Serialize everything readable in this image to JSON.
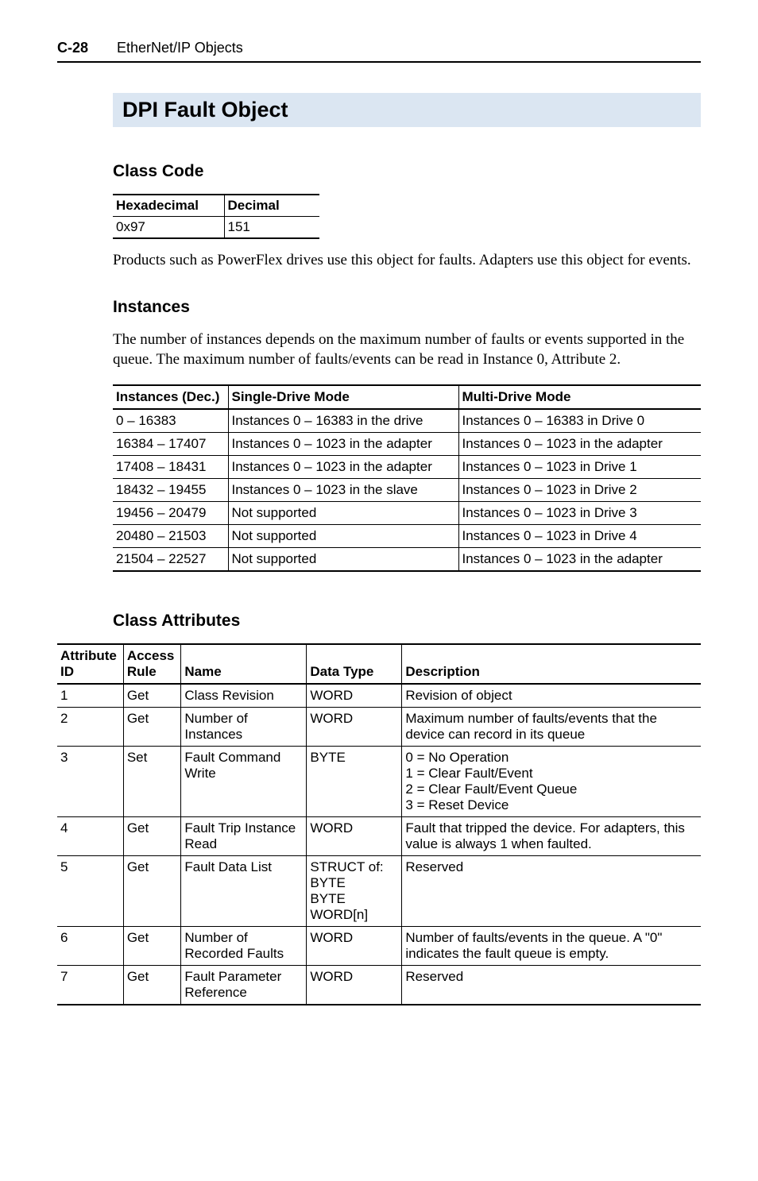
{
  "header": {
    "page_num": "C-28",
    "running_title": "EtherNet/IP Objects"
  },
  "section_title": "DPI Fault Object",
  "class_code": {
    "heading": "Class Code",
    "cols": [
      "Hexadecimal",
      "Decimal"
    ],
    "row": [
      "0x97",
      "151"
    ]
  },
  "intro_para": "Products such as PowerFlex drives use this object for faults. Adapters use this object for events.",
  "instances": {
    "heading": "Instances",
    "para": "The number of instances depends on the maximum number of faults or events supported in the queue. The maximum number of faults/events can be read in Instance 0, Attribute 2.",
    "cols": [
      "Instances (Dec.)",
      "Single-Drive Mode",
      "Multi-Drive Mode"
    ],
    "rows": [
      [
        "0 – 16383",
        "Instances 0 – 16383 in the drive",
        "Instances 0 – 16383 in Drive 0"
      ],
      [
        "16384 – 17407",
        "Instances 0 – 1023 in the adapter",
        "Instances 0 – 1023 in the adapter"
      ],
      [
        "17408 – 18431",
        "Instances 0 – 1023 in the adapter",
        "Instances 0 – 1023 in Drive 1"
      ],
      [
        "18432 – 19455",
        "Instances 0 – 1023 in the slave",
        "Instances 0 – 1023 in Drive 2"
      ],
      [
        "19456 – 20479",
        "Not supported",
        "Instances 0 – 1023 in Drive 3"
      ],
      [
        "20480 – 21503",
        "Not supported",
        "Instances 0 – 1023 in Drive 4"
      ],
      [
        "21504 – 22527",
        "Not supported",
        "Instances 0 – 1023 in the adapter"
      ]
    ]
  },
  "class_attrs": {
    "heading": "Class Attributes",
    "cols": [
      "Attribute\nID",
      "Access\nRule",
      "Name",
      "Data Type",
      "Description"
    ],
    "rows": [
      [
        "1",
        "Get",
        "Class Revision",
        "WORD",
        "Revision of object"
      ],
      [
        "2",
        "Get",
        "Number of Instances",
        "WORD",
        "Maximum number of faults/events that the device can record in its queue"
      ],
      [
        "3",
        "Set",
        "Fault Command Write",
        "BYTE",
        "0 = No Operation\n1 = Clear Fault/Event\n2 = Clear Fault/Event Queue\n3 = Reset Device"
      ],
      [
        "4",
        "Get",
        "Fault Trip Instance Read",
        "WORD",
        "Fault that tripped the device. For adapters, this value is always 1 when faulted."
      ],
      [
        "5",
        "Get",
        "Fault Data List",
        "STRUCT of:\n   BYTE\n   BYTE\n   WORD[n]",
        "Reserved"
      ],
      [
        "6",
        "Get",
        "Number of Recorded Faults",
        "WORD",
        "Number of faults/events in the queue. A \"0\" indicates the fault queue is empty."
      ],
      [
        "7",
        "Get",
        "Fault Parameter Reference",
        "WORD",
        "Reserved"
      ]
    ]
  }
}
